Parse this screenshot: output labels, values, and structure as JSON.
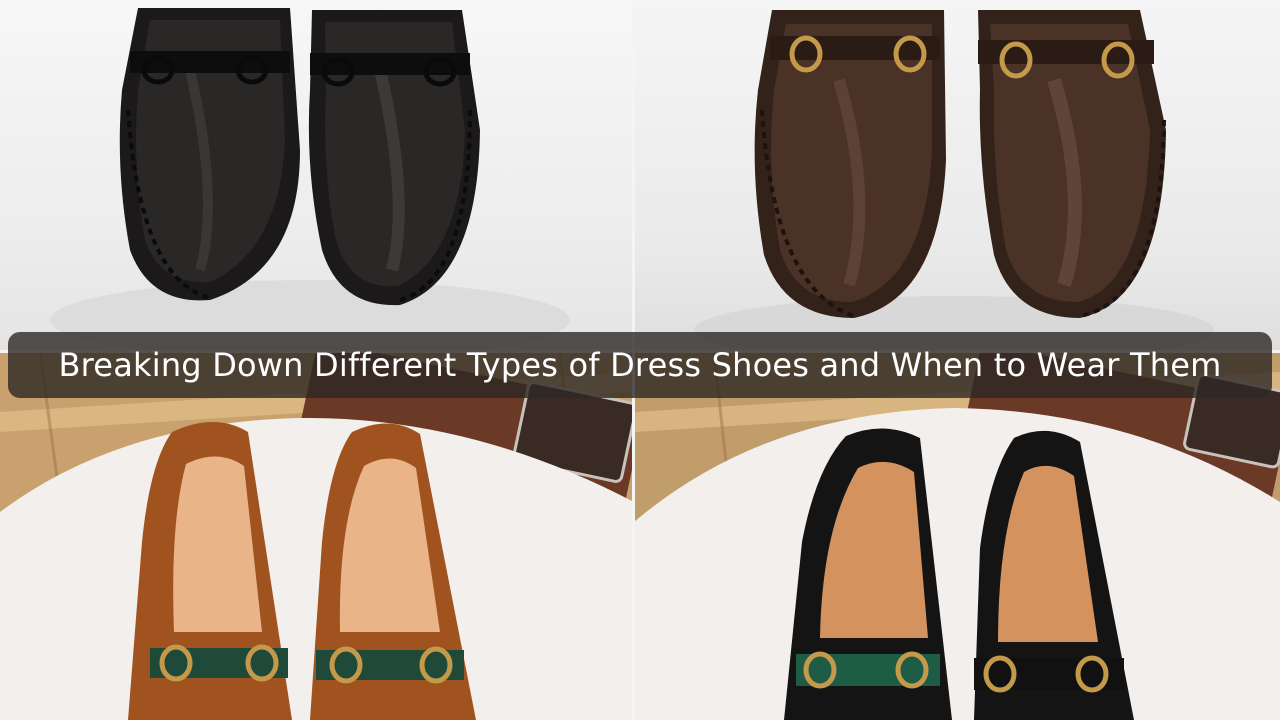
{
  "caption": {
    "title": "Breaking Down Different Types of Dress Shoes and When to Wear Them"
  },
  "photos": [
    {
      "position": "top-left",
      "subject": "black leather loafers with black horsebit hardware"
    },
    {
      "position": "top-right",
      "subject": "dark brown leather loafers with gold horsebit hardware"
    },
    {
      "position": "bottom-left",
      "subject": "tan brown leather loafers with green web strap and gold horsebit"
    },
    {
      "position": "bottom-right",
      "subject": "black leather loafers with green web strap and gold horsebit"
    }
  ],
  "colors": {
    "caption_background": "#2d2824",
    "caption_text": "#ffffff",
    "black_leather": "#1a1818",
    "brown_leather": "#3e2a20",
    "tan_leather": "#a85a2a",
    "green_strap": "#1f5c46",
    "gold_hardware": "#c49a4a"
  }
}
